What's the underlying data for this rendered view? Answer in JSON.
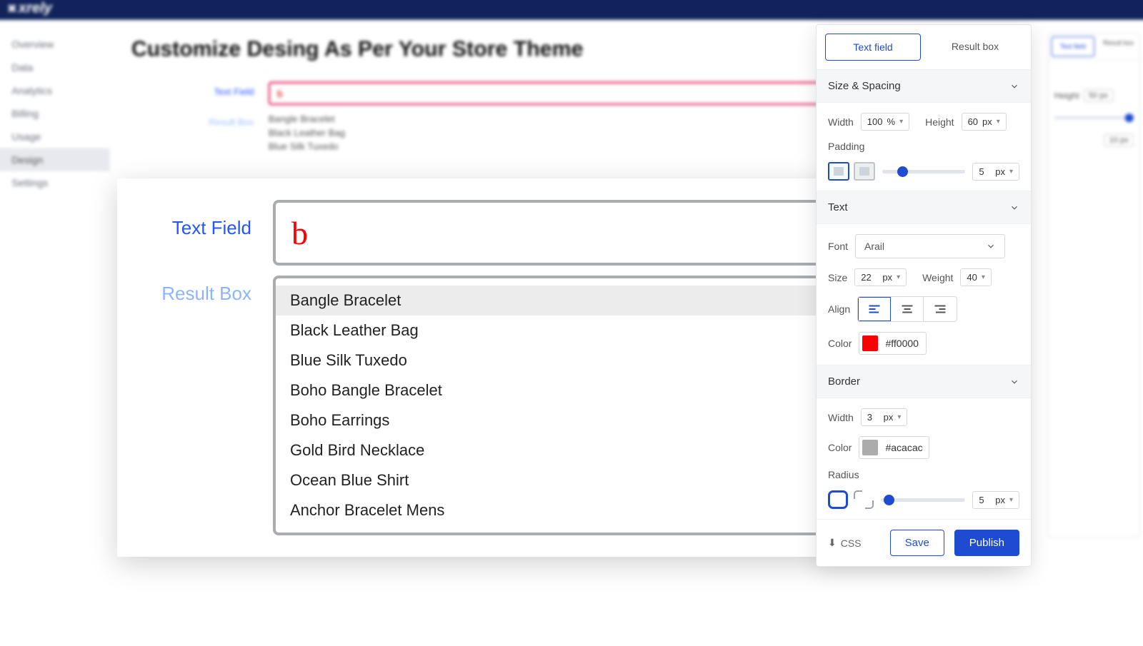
{
  "brand": "xrely",
  "sidebar": {
    "items": [
      "Overview",
      "Data",
      "Analytics",
      "Billing",
      "Usage",
      "Design",
      "Settings"
    ],
    "active_index": 5
  },
  "page_title": "Customize Desing As Per Your Store Theme",
  "bg_form": {
    "text_field_label": "Text Field",
    "text_field_value": "b",
    "result_box_label": "Result Box",
    "results": [
      "Bangle Bracelet",
      "Black Leather Bag",
      "Blue Silk Tuxedo"
    ]
  },
  "bg_right_tabs": [
    "Text field",
    "Result box"
  ],
  "bg_right_height": {
    "label": "Height",
    "value": "50",
    "unit": "px"
  },
  "bg_right_pad": {
    "value": "10",
    "unit": "px"
  },
  "preview": {
    "text_field_label": "Text Field",
    "text_field_value": "b",
    "result_box_label": "Result Box",
    "results": [
      "Bangle Bracelet",
      "Black Leather Bag",
      "Blue Silk Tuxedo",
      "Boho Bangle Bracelet",
      "Boho Earrings",
      "Gold Bird Necklace",
      "Ocean Blue Shirt",
      "Anchor Bracelet Mens"
    ]
  },
  "panel": {
    "tabs": {
      "text_field": "Text field",
      "result_box": "Result box"
    },
    "size_spacing": {
      "title": "Size & Spacing",
      "width_label": "Width",
      "width_value": "100",
      "width_unit": "%",
      "height_label": "Height",
      "height_value": "60",
      "height_unit": "px",
      "padding_label": "Padding",
      "padding_value": "5",
      "padding_unit": "px",
      "padding_slider_pct": 18
    },
    "text": {
      "title": "Text",
      "font_label": "Font",
      "font_value": "Arail",
      "size_label": "Size",
      "size_value": "22",
      "size_unit": "px",
      "weight_label": "Weight",
      "weight_value": "40",
      "align_label": "Align",
      "color_label": "Color",
      "color_hex": "#ff0000"
    },
    "border": {
      "title": "Border",
      "width_label": "Width",
      "width_value": "3",
      "width_unit": "px",
      "color_label": "Color",
      "color_hex": "#acacac",
      "radius_label": "Radius",
      "radius_value": "5",
      "radius_unit": "px",
      "radius_slider_pct": 3
    },
    "footer": {
      "css": "CSS",
      "save": "Save",
      "publish": "Publish"
    }
  }
}
